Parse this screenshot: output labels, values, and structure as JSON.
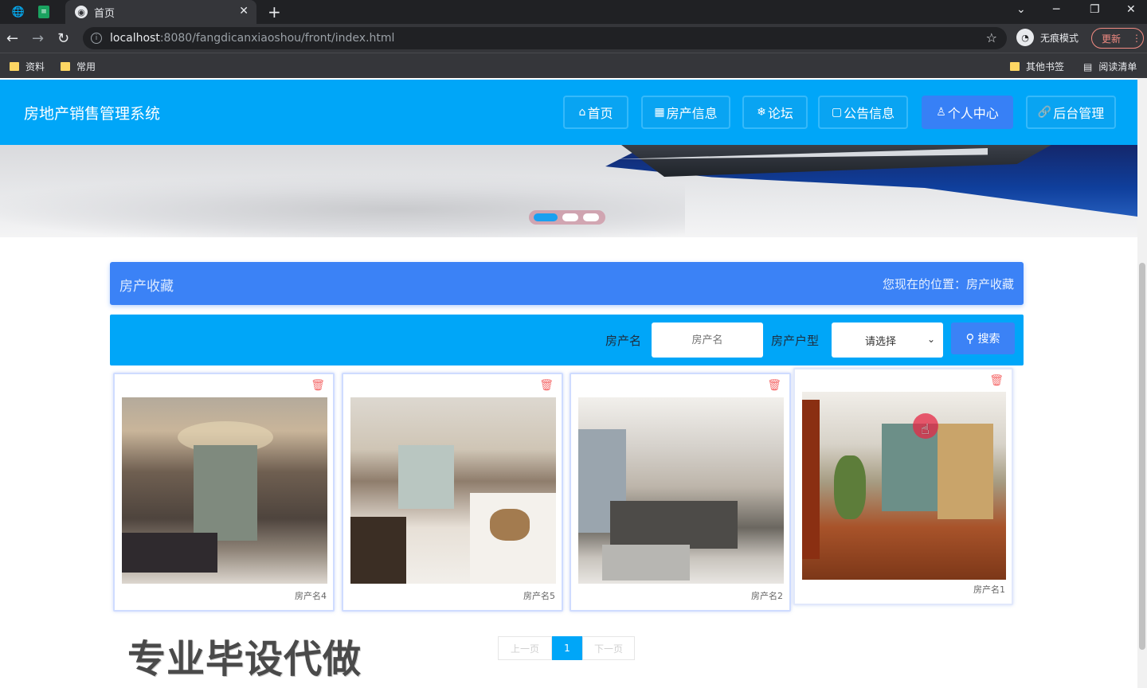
{
  "browser": {
    "tab_title": "首页",
    "url_host": "localhost",
    "url_path": ":8080/fangdicanxiaoshou/front/index.html",
    "incognito_label": "无痕模式",
    "update_label": "更新",
    "bookmarks_left": [
      "资料",
      "常用"
    ],
    "other_bookmarks": "其他书签",
    "reading_list": "阅读清单"
  },
  "header": {
    "site_title": "房地产销售管理系统",
    "menu": [
      {
        "label": "首页",
        "icon": "home-icon"
      },
      {
        "label": "房产信息",
        "icon": "grid-icon"
      },
      {
        "label": "论坛",
        "icon": "snowflake-icon"
      },
      {
        "label": "公告信息",
        "icon": "note-icon"
      },
      {
        "label": "个人中心",
        "icon": "user-icon"
      },
      {
        "label": "后台管理",
        "icon": "link-icon"
      }
    ],
    "active_index": 4,
    "accent": "#00a6f8",
    "active_color": "#3780f6"
  },
  "carousel": {
    "slide_count": 3,
    "active_slide": 1
  },
  "section": {
    "title": "房产收藏",
    "location_label": "您现在的位置：",
    "location_value": "房产收藏"
  },
  "search": {
    "name_label": "房产名",
    "name_placeholder": "房产名",
    "type_label": "房产户型",
    "type_value": "请选择",
    "button_label": "搜索"
  },
  "cards": [
    {
      "name": "房产名4",
      "icon": "trash-icon"
    },
    {
      "name": "房产名5",
      "icon": "trash-icon"
    },
    {
      "name": "房产名2",
      "icon": "trash-icon"
    },
    {
      "name": "房产名1",
      "icon": "trash-icon"
    }
  ],
  "pager": {
    "prev": "上一页",
    "current": "1",
    "next": "下一页"
  },
  "watermark": "专业毕设代做"
}
